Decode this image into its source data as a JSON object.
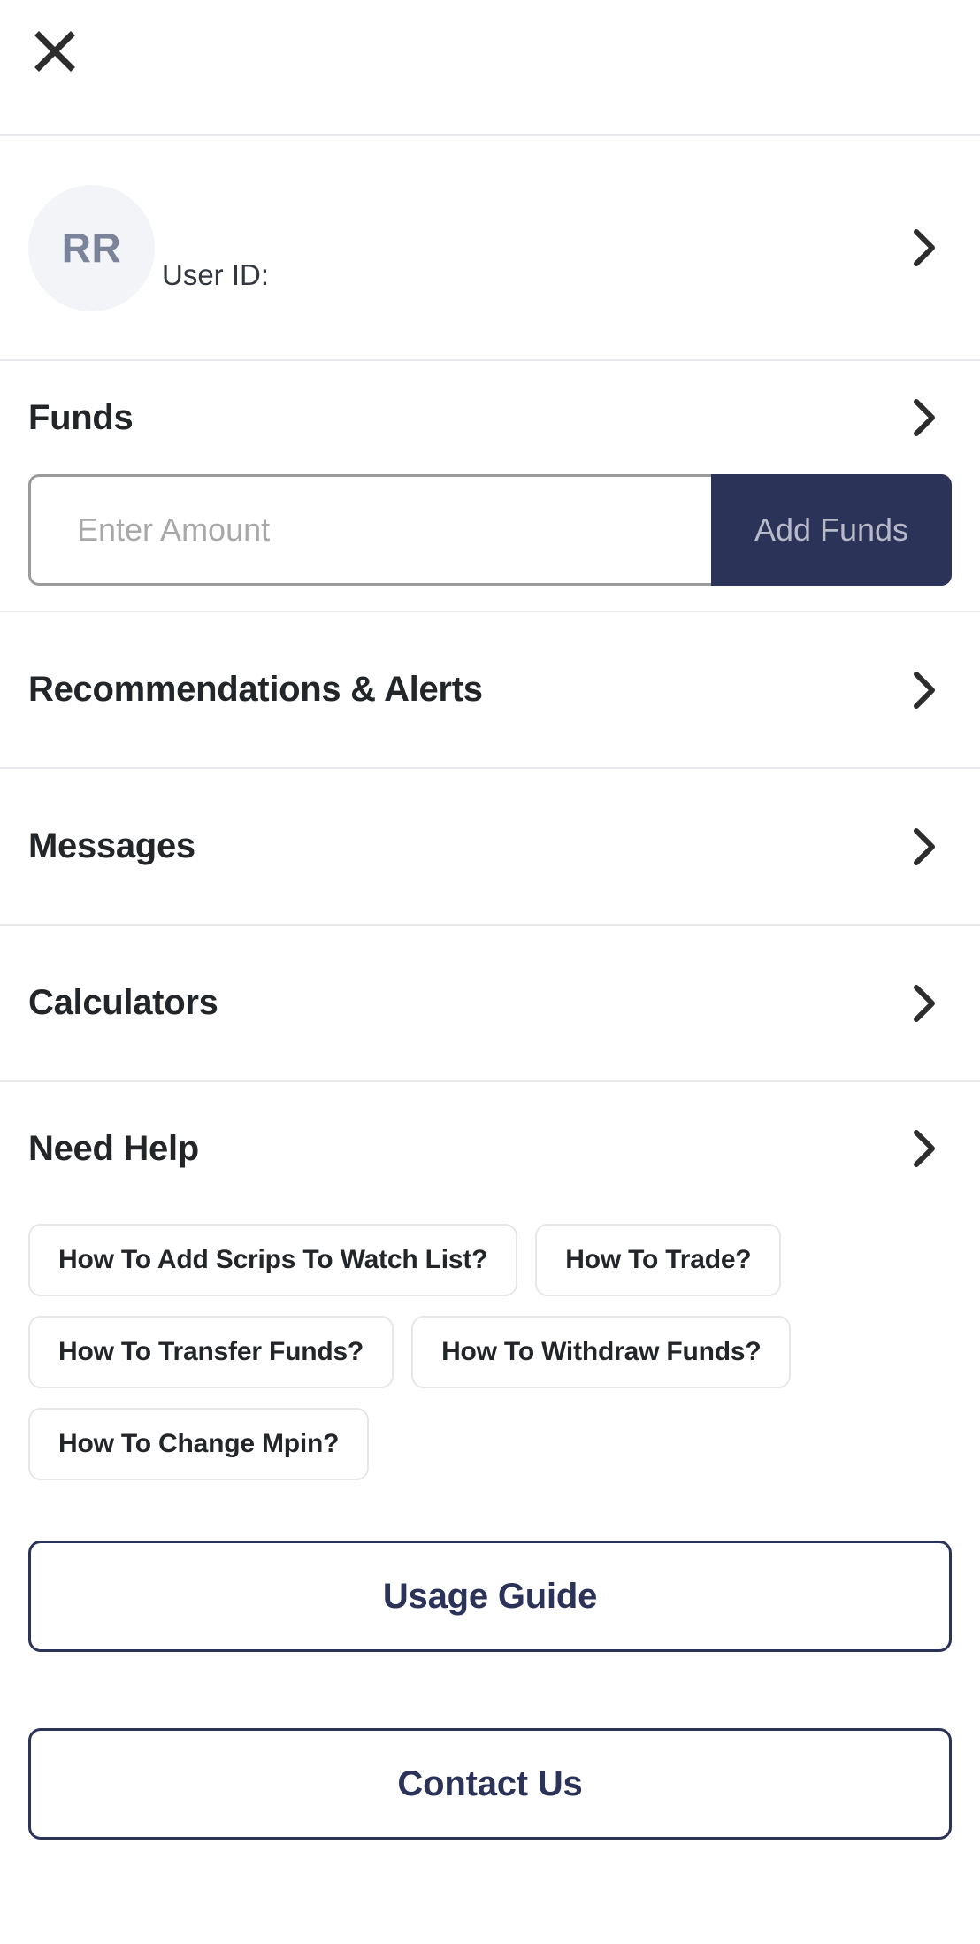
{
  "header": {
    "close_icon": "close-icon"
  },
  "profile": {
    "initials": "RR",
    "userid_label": "User ID:",
    "userid_value": "",
    "chevron_icon": "chevron-right-icon"
  },
  "funds": {
    "title": "Funds",
    "chevron_icon": "chevron-right-icon",
    "amount_placeholder": "Enter Amount",
    "amount_value": "",
    "add_funds_label": "Add Funds",
    "add_funds_bg": "#2c3358",
    "add_funds_text_color": "#b7bac8"
  },
  "nav_items": [
    {
      "label": "Recommendations & Alerts",
      "chevron_icon": "chevron-right-icon"
    },
    {
      "label": "Messages",
      "chevron_icon": "chevron-right-icon"
    },
    {
      "label": "Calculators",
      "chevron_icon": "chevron-right-icon"
    }
  ],
  "help": {
    "title": "Need Help",
    "chevron_icon": "chevron-right-icon",
    "chips": [
      "How To Add Scrips To Watch List?",
      "How To Trade?",
      "How To Transfer Funds?",
      "How To Withdraw Funds?",
      "How To Change Mpin?"
    ],
    "usage_guide_label": "Usage Guide",
    "contact_us_label": "Contact Us"
  },
  "colors": {
    "accent_navy": "#2c3358",
    "divider": "#e8e9ec",
    "avatar_bg": "#f2f4f8",
    "avatar_text": "#7b839b",
    "heading_text": "#232629",
    "placeholder": "#a8a8a8"
  }
}
